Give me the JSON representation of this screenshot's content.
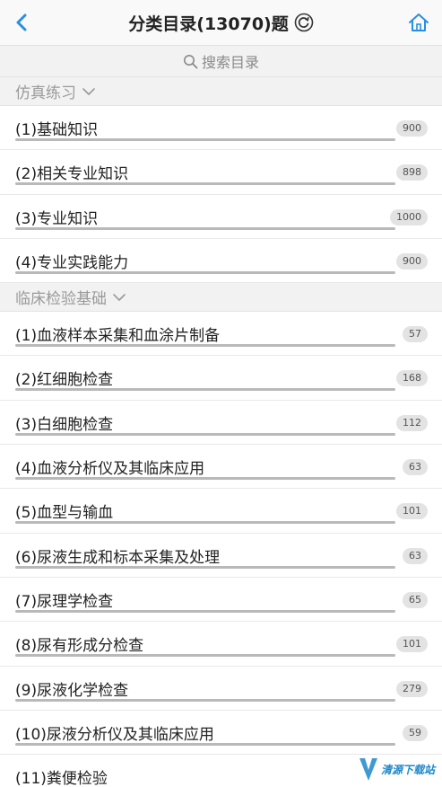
{
  "header": {
    "title": "分类目录(13070)题",
    "back_icon": "chevron-left-icon",
    "refresh_icon": "refresh-icon",
    "home_icon": "home-icon",
    "accent_color": "#2a8fe0"
  },
  "search": {
    "placeholder": "搜索目录",
    "icon": "search-icon"
  },
  "sections": [
    {
      "title": "仿真练习",
      "expanded": true,
      "items": [
        {
          "label": "(1)基础知识",
          "count": "900"
        },
        {
          "label": "(2)相关专业知识",
          "count": "898"
        },
        {
          "label": "(3)专业知识",
          "count": "1000"
        },
        {
          "label": "(4)专业实践能力",
          "count": "900"
        }
      ]
    },
    {
      "title": "临床检验基础",
      "expanded": true,
      "items": [
        {
          "label": "(1)血液样本采集和血涂片制备",
          "count": "57"
        },
        {
          "label": "(2)红细胞检查",
          "count": "168"
        },
        {
          "label": "(3)白细胞检查",
          "count": "112"
        },
        {
          "label": "(4)血液分析仪及其临床应用",
          "count": "63"
        },
        {
          "label": "(5)血型与输血",
          "count": "101"
        },
        {
          "label": "(6)尿液生成和标本采集及处理",
          "count": "63"
        },
        {
          "label": "(7)尿理学检查",
          "count": "65"
        },
        {
          "label": "(8)尿有形成分检查",
          "count": "101"
        },
        {
          "label": "(9)尿液化学检查",
          "count": "279"
        },
        {
          "label": "(10)尿液分析仪及其临床应用",
          "count": "59"
        },
        {
          "label": "(11)粪便检验",
          "count": ""
        }
      ]
    }
  ],
  "watermark": {
    "text": "清源下载站"
  }
}
